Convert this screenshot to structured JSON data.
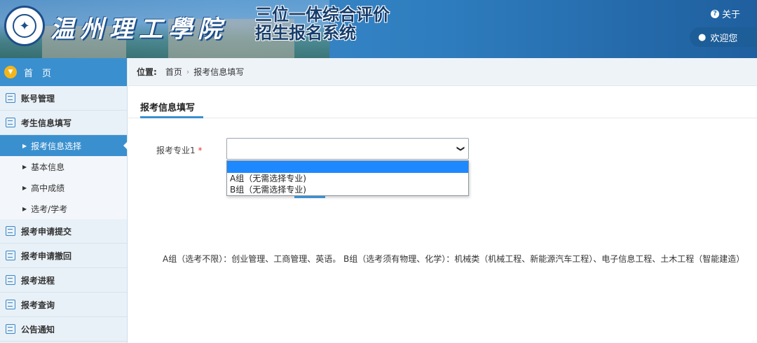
{
  "header": {
    "school_name": "温州理工學院",
    "system_title_line1": "三位一体综合评价",
    "system_title_line2": "招生报名系统",
    "about_label": "关于",
    "welcome_label": "欢迎您"
  },
  "sidebar": {
    "home_label": "首　页",
    "items": [
      {
        "label": "账号管理",
        "icon": "list-icon"
      },
      {
        "label": "考生信息填写",
        "icon": "edit-icon"
      },
      {
        "label": "报考申请提交",
        "icon": "calendar-icon"
      },
      {
        "label": "报考申请撤回",
        "icon": "calendar-icon"
      },
      {
        "label": "报考进程",
        "icon": "calendar-icon"
      },
      {
        "label": "报考查询",
        "icon": "calendar-icon"
      },
      {
        "label": "公告通知",
        "icon": "message-icon"
      }
    ],
    "sub_items": [
      "报考信息选择",
      "基本信息",
      "高中成绩",
      "选考/学考"
    ],
    "active_sub": "报考信息选择"
  },
  "breadcrumb": {
    "prefix": "位置:",
    "items": [
      "首页",
      "报考信息填写"
    ]
  },
  "main": {
    "section_title": "报考信息填写",
    "field_label": "报考专业1",
    "required_mark": "*",
    "select_value": "",
    "options": [
      "",
      "A组（无需选择专业)",
      "B组（无需选择专业)"
    ],
    "note": "A组（选考不限）：创业管理、工商管理、英语。 B组（选考须有物理、化学）：机械类（机械工程、新能源汽车工程）、电子信息工程、土木工程（智能建造）"
  },
  "colors": {
    "accent": "#3a90cf",
    "header_blue": "#2f7fc0",
    "dropdown_highlight": "#1e88ff"
  }
}
